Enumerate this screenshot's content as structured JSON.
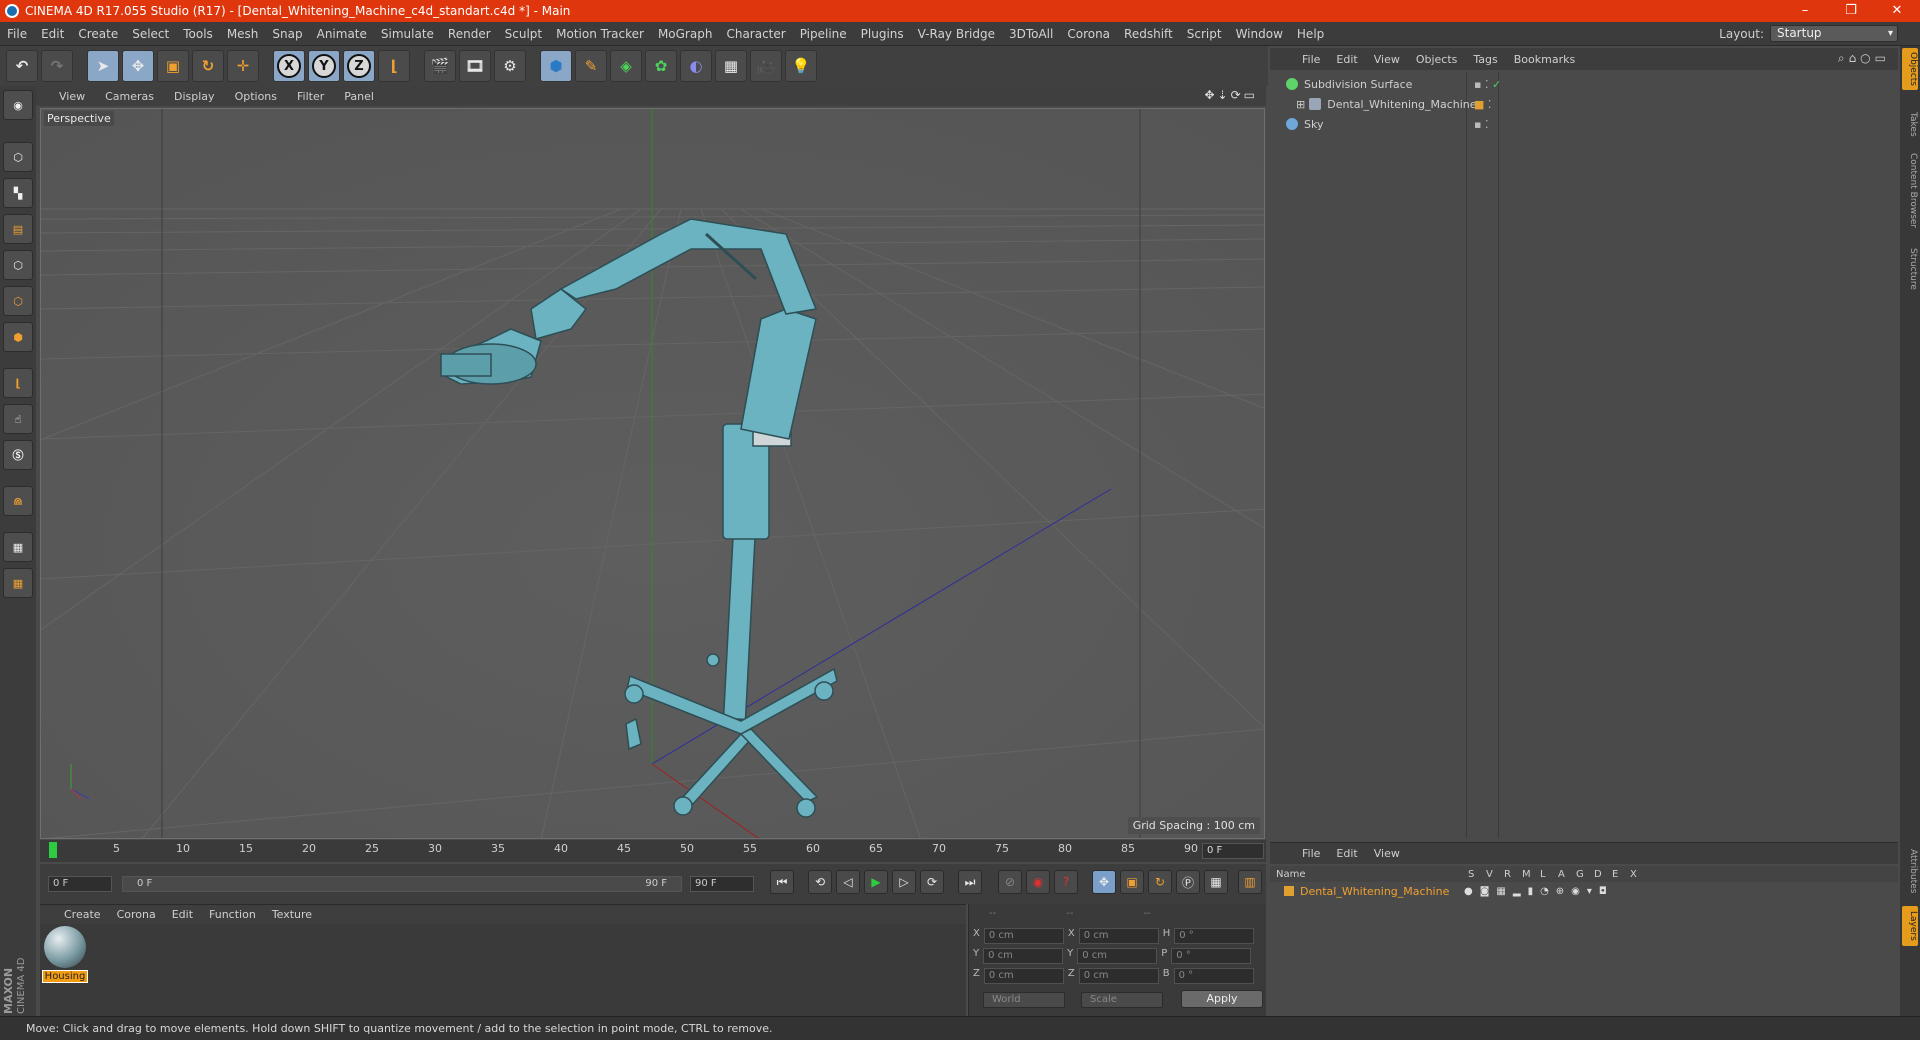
{
  "window": {
    "title": "CINEMA 4D R17.055 Studio (R17) - [Dental_Whitening_Machine_c4d_standart.c4d *] - Main",
    "controls": [
      "–",
      "❐",
      "✕"
    ]
  },
  "menu": [
    "File",
    "Edit",
    "Create",
    "Select",
    "Tools",
    "Mesh",
    "Snap",
    "Animate",
    "Simulate",
    "Render",
    "Sculpt",
    "Motion Tracker",
    "MoGraph",
    "Character",
    "Pipeline",
    "Plugins",
    "V-Ray Bridge",
    "3DToAll",
    "Corona",
    "Redshift",
    "Script",
    "Window",
    "Help"
  ],
  "layout": {
    "label": "Layout:",
    "value": "Startup"
  },
  "toolbar": {
    "axis_x": "X",
    "axis_y": "Y",
    "axis_z": "Z"
  },
  "viewport": {
    "menu": [
      "View",
      "Cameras",
      "Display",
      "Options",
      "Filter",
      "Panel"
    ],
    "label": "Perspective",
    "grid_spacing": "Grid Spacing : 100 cm"
  },
  "timeline": {
    "ticks": [
      "0",
      "5",
      "10",
      "15",
      "20",
      "25",
      "30",
      "35",
      "40",
      "45",
      "50",
      "55",
      "60",
      "65",
      "70",
      "75",
      "80",
      "85",
      "90"
    ],
    "current_frame": "0 F",
    "start_field": "0 F",
    "range_start": "0 F",
    "range_end": "90 F",
    "end_field": "90 F"
  },
  "material_manager": {
    "menu": [
      "Create",
      "Corona",
      "Edit",
      "Function",
      "Texture"
    ],
    "material_name": "Housing"
  },
  "coordinates": {
    "header": [
      "--",
      "--",
      "--"
    ],
    "rows": [
      {
        "a": "X",
        "av": "0 cm",
        "b": "X",
        "bv": "0 cm",
        "c": "H",
        "cv": "0 °"
      },
      {
        "a": "Y",
        "av": "0 cm",
        "b": "Y",
        "bv": "0 cm",
        "c": "P",
        "cv": "0 °"
      },
      {
        "a": "Z",
        "av": "0 cm",
        "b": "Z",
        "bv": "0 cm",
        "c": "B",
        "cv": "0 °"
      }
    ],
    "world": "World",
    "scale": "Scale",
    "apply": "Apply"
  },
  "object_manager": {
    "menu": [
      "File",
      "Edit",
      "View",
      "Objects",
      "Tags",
      "Bookmarks"
    ],
    "objects": [
      {
        "name": "Subdivision Surface",
        "color": "#5fd36a"
      },
      {
        "name": "Dental_Whitening_Machine",
        "color": "#9aa6b5"
      },
      {
        "name": "Sky",
        "color": "#6fa7d8"
      }
    ]
  },
  "layer_manager": {
    "menu": [
      "File",
      "Edit",
      "View"
    ],
    "columns": [
      "Name",
      "S",
      "V",
      "R",
      "M",
      "L",
      "A",
      "G",
      "D",
      "E",
      "X"
    ],
    "layer_name": "Dental_Whitening_Machine",
    "layer_color": "#e0a030"
  },
  "side_tabs": [
    "Objects",
    "Takes",
    "Content Browser",
    "Structure",
    "Attributes",
    "Layers"
  ],
  "brand": {
    "line1": "MAXON",
    "line2": "CINEMA 4D"
  },
  "status": "Move: Click and drag to move elements. Hold down SHIFT to quantize movement / add to the selection in point mode, CTRL to remove.",
  "colors": {
    "titlebar": "#e0360d",
    "model": "#6bb3c0",
    "accent": "#e59b1c"
  }
}
